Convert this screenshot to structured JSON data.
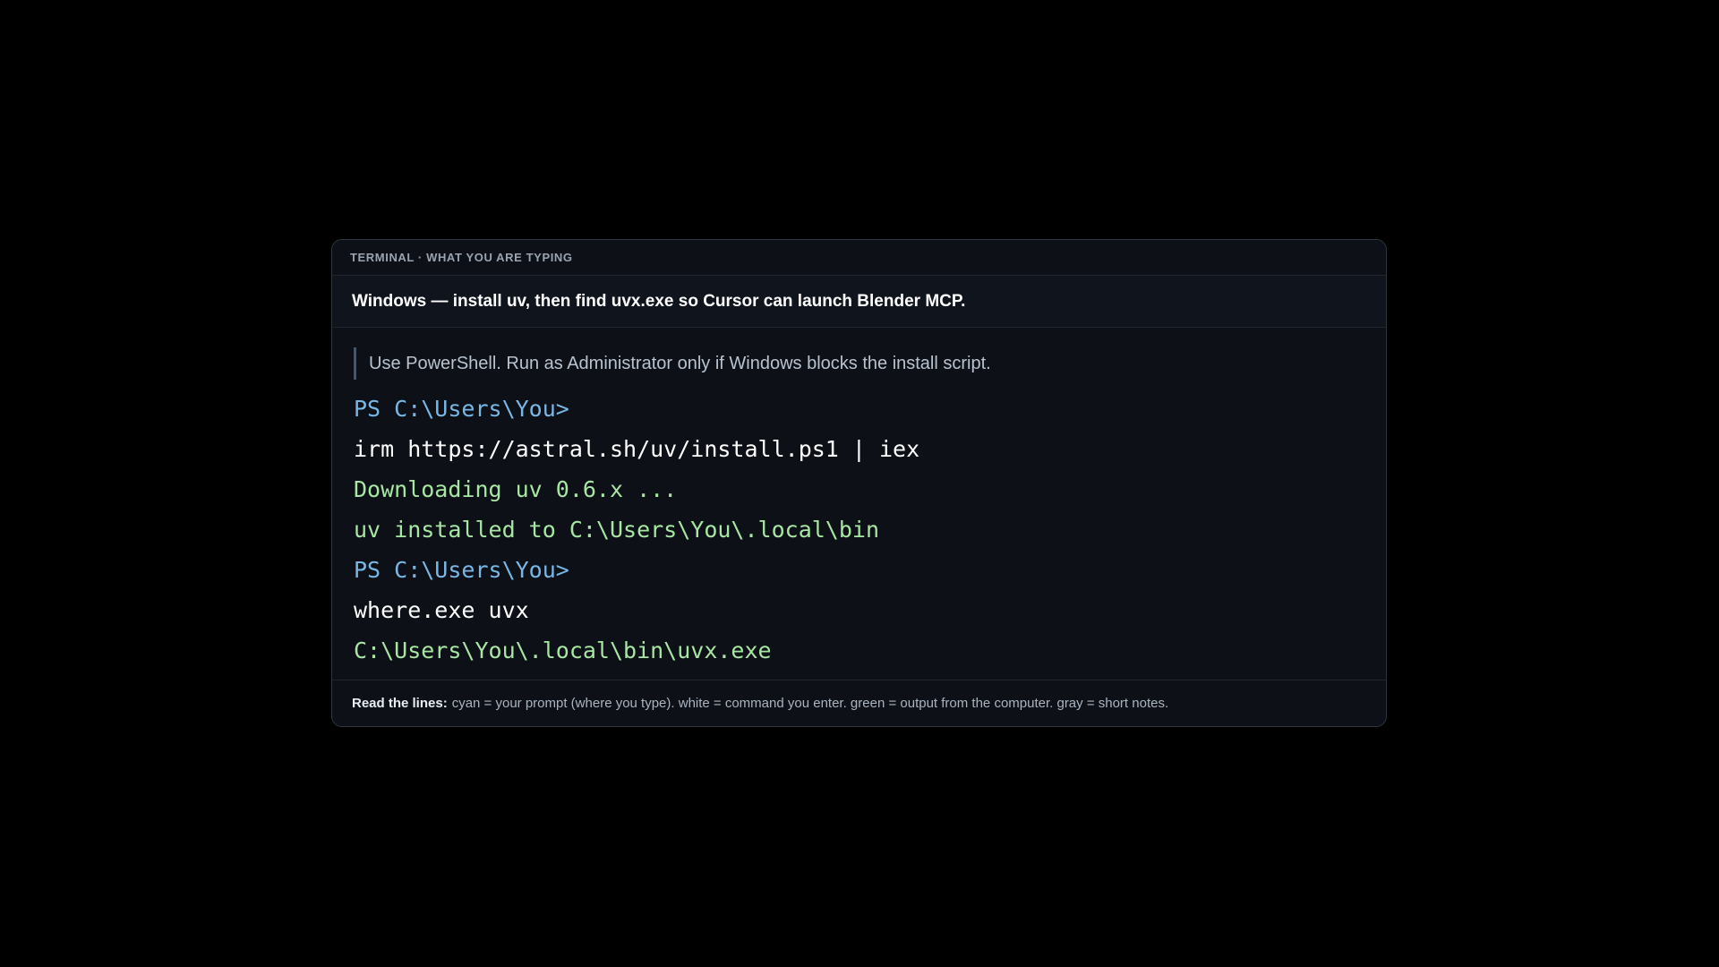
{
  "header": {
    "label": "TERMINAL · WHAT YOU ARE TYPING"
  },
  "title": "Windows — install uv, then find uvx.exe so Cursor can launch Blender MCP.",
  "note": "Use PowerShell. Run as Administrator only if Windows blocks the install script.",
  "lines": [
    {
      "kind": "prompt",
      "text": "PS C:\\Users\\You>"
    },
    {
      "kind": "command",
      "text": "irm https://astral.sh/uv/install.ps1 | iex"
    },
    {
      "kind": "output",
      "text": "Downloading uv 0.6.x ..."
    },
    {
      "kind": "output",
      "text": "uv installed to C:\\Users\\You\\.local\\bin"
    },
    {
      "kind": "prompt",
      "text": "PS C:\\Users\\You>"
    },
    {
      "kind": "command",
      "text": "where.exe uvx"
    },
    {
      "kind": "output",
      "text": "C:\\Users\\You\\.local\\bin\\uvx.exe"
    }
  ],
  "footer": {
    "lead": "Read the lines:",
    "text": "cyan = your prompt (where you type). white = command you enter. green = output from the computer. gray = short notes."
  },
  "colors": {
    "prompt": "#79b8e6",
    "command": "#ffffff",
    "output": "#a8e6a3",
    "note": "#b9c3cf"
  }
}
